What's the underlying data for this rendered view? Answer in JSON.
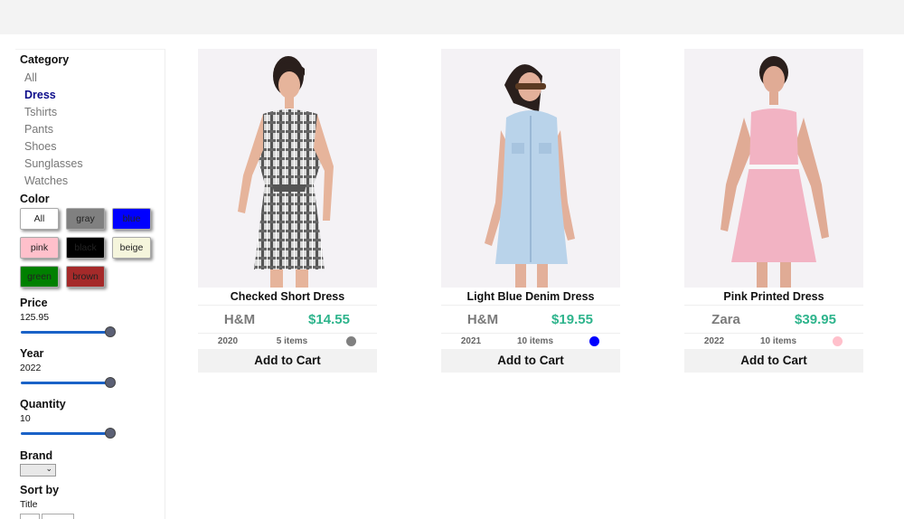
{
  "filters": {
    "category_title": "Category",
    "categories": [
      "All",
      "Dress",
      "Tshirts",
      "Pants",
      "Shoes",
      "Sunglasses",
      "Watches"
    ],
    "active_category": "Dress",
    "color_title": "Color",
    "colors": [
      {
        "label": "All",
        "bg": "#ffffff"
      },
      {
        "label": "gray",
        "bg": "#808080"
      },
      {
        "label": "blue",
        "bg": "#0000ff"
      },
      {
        "label": "pink",
        "bg": "#ffc0cb"
      },
      {
        "label": "black",
        "bg": "#000000"
      },
      {
        "label": "beige",
        "bg": "#f5f5dc"
      },
      {
        "label": "green",
        "bg": "#008000"
      },
      {
        "label": "brown",
        "bg": "#a52a2a"
      }
    ],
    "price": {
      "title": "Price",
      "value": "125.95",
      "level": 1.0
    },
    "year": {
      "title": "Year",
      "value": "2022",
      "level": 1.0
    },
    "quantity": {
      "title": "Quantity",
      "value": "10",
      "level": 1.0
    },
    "brand_title": "Brand",
    "sort_title": "Sort by",
    "sort_value": "Title"
  },
  "products": [
    {
      "name": "Checked Short Dress",
      "brand": "H&M",
      "price": "$14.55",
      "year": "2020",
      "items": "5 items",
      "color": "#808080",
      "cart_label": "Add to Cart",
      "image_icon": "dress-photo"
    },
    {
      "name": "Light Blue Denim Dress",
      "brand": "H&M",
      "price": "$19.55",
      "year": "2021",
      "items": "10 items",
      "color": "#0000ff",
      "cart_label": "Add to Cart",
      "image_icon": "dress-photo"
    },
    {
      "name": "Pink Printed Dress",
      "brand": "Zara",
      "price": "$39.95",
      "year": "2022",
      "items": "10 items",
      "color": "#ffc0cb",
      "cart_label": "Add to Cart",
      "image_icon": "dress-photo"
    }
  ]
}
